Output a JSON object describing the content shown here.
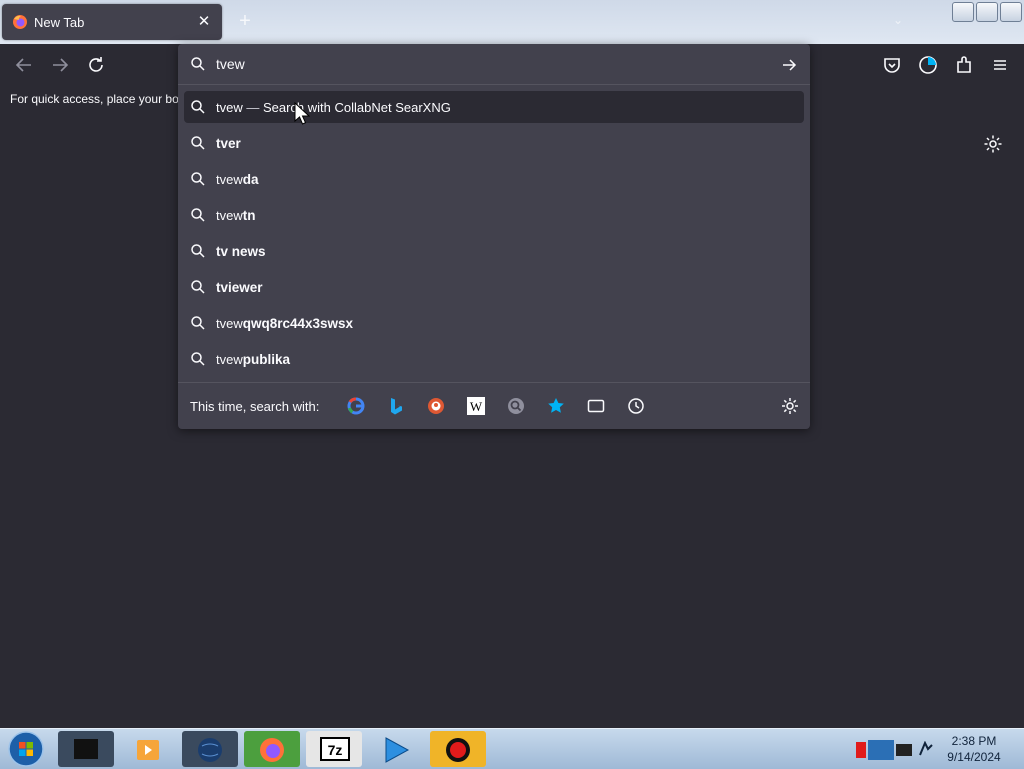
{
  "tab": {
    "title": "New Tab",
    "close": "✕"
  },
  "window": {
    "new_tab": "+",
    "list_tabs": "⌄"
  },
  "bookmarks_bar": {
    "message": "For quick access, place your boo"
  },
  "urlbar": {
    "value": "tvew",
    "results": [
      {
        "prefix": "tvew",
        "sep": " — ",
        "action": "Search with CollabNet SearXNG",
        "suffix": "",
        "selected": true
      },
      {
        "prefix": "",
        "suffix": "tver"
      },
      {
        "prefix": "tvew",
        "suffix": "da"
      },
      {
        "prefix": "tvew",
        "suffix": "tn"
      },
      {
        "prefix": "",
        "suffix": "tv news"
      },
      {
        "prefix": "",
        "suffix": "tviewer"
      },
      {
        "prefix": "tvew",
        "suffix": "qwq8rc44x3swsx"
      },
      {
        "prefix": "tvew",
        "suffix": "publika"
      }
    ],
    "oneoff_label": "This time, search with:",
    "engines": [
      "google-icon",
      "bing-icon",
      "duckduckgo-icon",
      "wikipedia-icon",
      "searxng-icon",
      "bookmarks-icon",
      "tabs-icon",
      "history-icon"
    ]
  },
  "taskbar": {
    "time": "2:38 PM",
    "date": "9/14/2024"
  },
  "colors": {
    "page_bg": "#2b2a33",
    "popup_bg": "#42414d",
    "accent": "#00b3f4"
  }
}
